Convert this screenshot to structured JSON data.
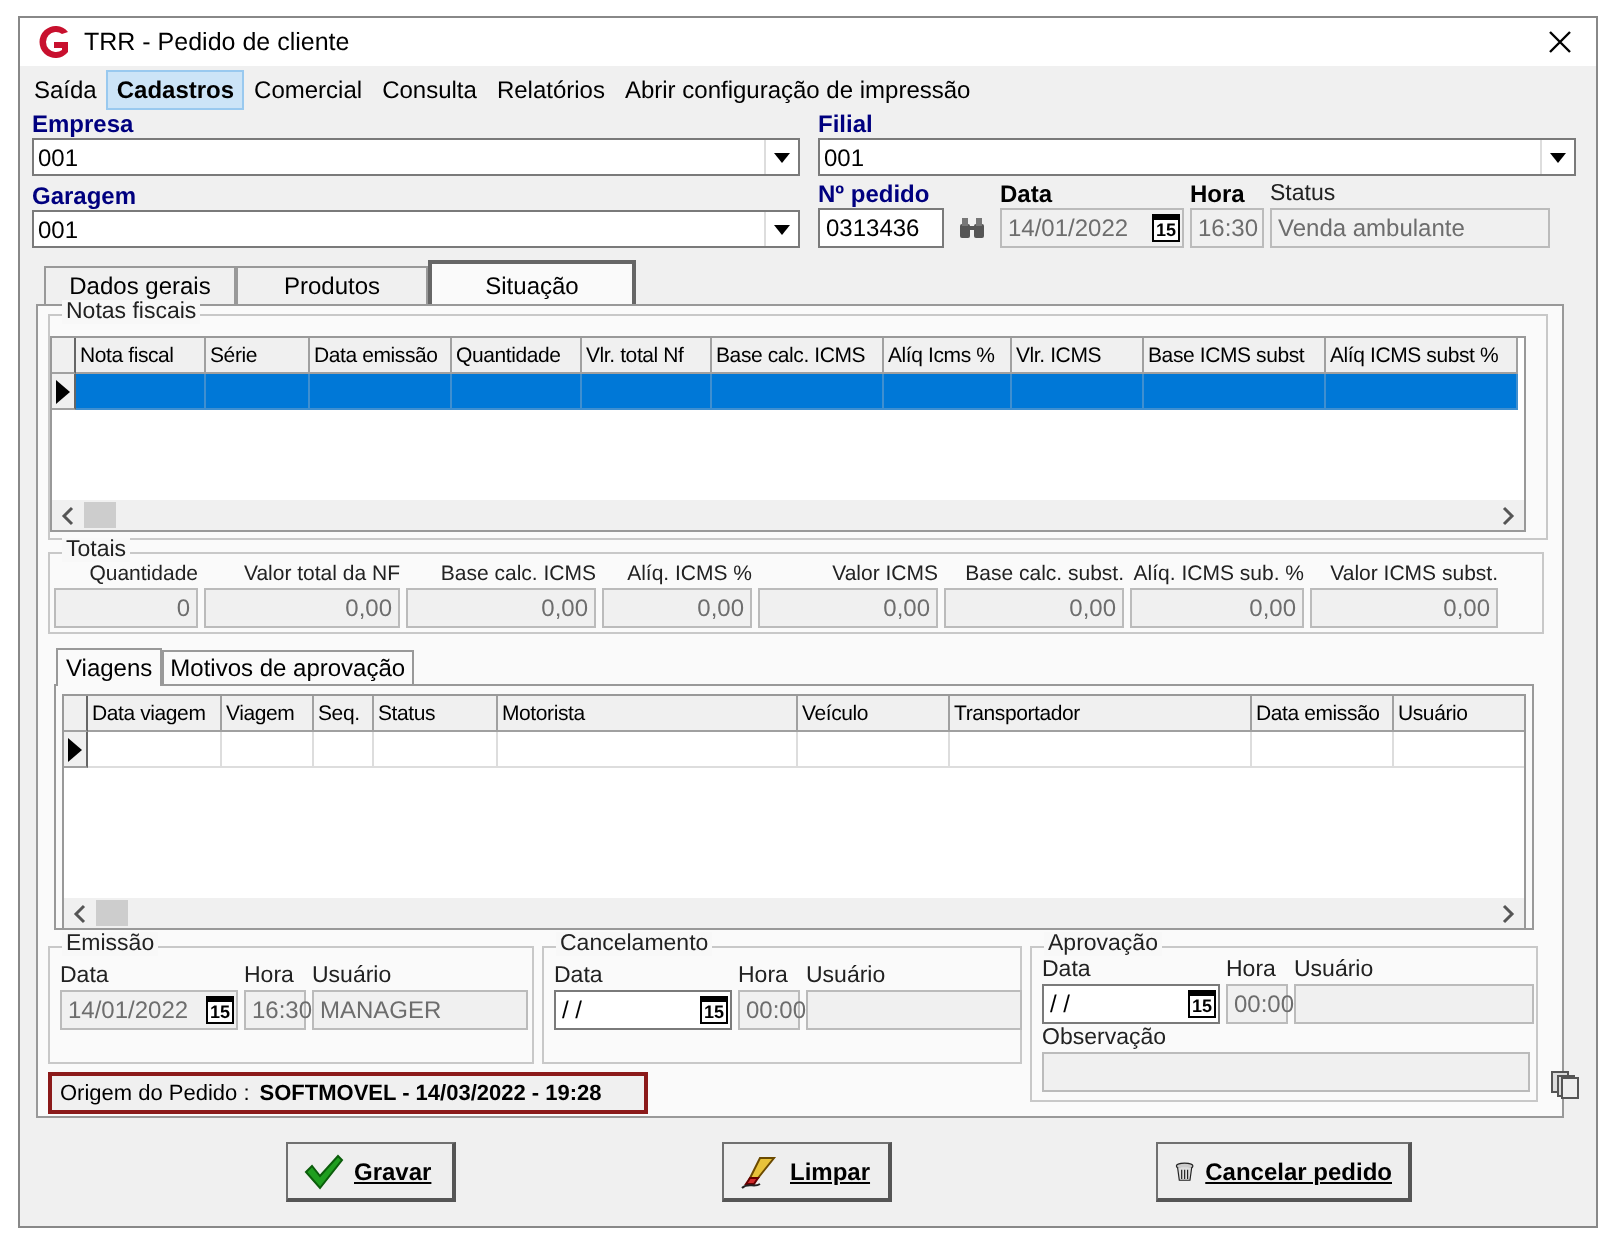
{
  "window": {
    "title": "TRR - Pedido de cliente"
  },
  "menu": [
    {
      "label": "Saída",
      "selected": false
    },
    {
      "label": "Cadastros",
      "selected": true
    },
    {
      "label": "Comercial",
      "selected": false
    },
    {
      "label": "Consulta",
      "selected": false
    },
    {
      "label": "Relatórios",
      "selected": false
    },
    {
      "label": "Abrir configuração de impressão",
      "selected": false
    }
  ],
  "header": {
    "empresa": {
      "label": "Empresa",
      "value": "001"
    },
    "filial": {
      "label": "Filial",
      "value": "001"
    },
    "garagem": {
      "label": "Garagem",
      "value": "001"
    },
    "pedido": {
      "label": "Nº pedido",
      "value": "0313436",
      "disabled": false
    },
    "data": {
      "label": "Data",
      "value": "14/01/2022",
      "button": "15",
      "disabled": true
    },
    "hora": {
      "label": "Hora",
      "value": "16:30",
      "disabled": true
    },
    "status": {
      "label": "Status",
      "value": "Venda ambulante",
      "disabled": true
    }
  },
  "tabs": [
    {
      "label": "Dados gerais",
      "selected": false
    },
    {
      "label": "Produtos",
      "selected": false
    },
    {
      "label": "Situação",
      "selected": true
    }
  ],
  "notas_fiscais": {
    "title": "Notas fiscais",
    "columns": [
      "Nota fiscal",
      "Série",
      "Data emissão",
      "Quantidade",
      "Vlr. total Nf",
      "Base calc. ICMS",
      "Alíq Icms %",
      "Vlr. ICMS",
      "Base ICMS subst",
      "Alíq ICMS subst %"
    ],
    "rows": [
      {
        "current": true,
        "selected": true
      }
    ]
  },
  "totais": {
    "title": "Totais",
    "fields": [
      {
        "label": "Quantidade",
        "value": "0",
        "disabled": true
      },
      {
        "label": "Valor total da NF",
        "value": "0,00",
        "disabled": true
      },
      {
        "label": "Base calc. ICMS",
        "value": "0,00",
        "disabled": true
      },
      {
        "label": "Alíq. ICMS %",
        "value": "0,00",
        "disabled": true
      },
      {
        "label": "Valor ICMS",
        "value": "0,00",
        "disabled": true
      },
      {
        "label": "Base calc. subst.",
        "value": "0,00",
        "disabled": true
      },
      {
        "label": "Alíq. ICMS sub. %",
        "value": "0,00",
        "disabled": true
      },
      {
        "label": "Valor ICMS subst.",
        "value": "0,00",
        "disabled": true
      }
    ]
  },
  "subtabs": [
    {
      "label": "Viagens",
      "selected": true
    },
    {
      "label": "Motivos de aprovação",
      "selected": false
    }
  ],
  "viagens": {
    "columns": [
      "Data viagem",
      "Viagem",
      "Seq.",
      "Status",
      "Motorista",
      "Veículo",
      "Transportador",
      "Data emissão",
      "Usuário"
    ],
    "rows": [
      {
        "current": true,
        "selected": false
      }
    ]
  },
  "emissao": {
    "title": "Emissão",
    "data": {
      "label": "Data",
      "value": "14/01/2022",
      "button": "15",
      "disabled": true
    },
    "hora": {
      "label": "Hora",
      "value": "16:30",
      "disabled": true
    },
    "usuario": {
      "label": "Usuário",
      "value": "MANAGER",
      "disabled": true
    }
  },
  "cancelamento": {
    "title": "Cancelamento",
    "data": {
      "label": "Data",
      "value": " / /",
      "button": "15",
      "disabled": false
    },
    "hora": {
      "label": "Hora",
      "value": "00:00",
      "disabled": true
    },
    "usuario": {
      "label": "Usuário",
      "disabled": true
    }
  },
  "aprovacao": {
    "title": "Aprovação",
    "data": {
      "label": "Data",
      "value": " / /",
      "button": "15",
      "disabled": false
    },
    "hora": {
      "label": "Hora",
      "value": "00:00",
      "disabled": true
    },
    "usuario": {
      "label": "Usuário",
      "disabled": true
    },
    "observacao": {
      "label": "Observação",
      "disabled": true
    }
  },
  "origem": {
    "label": "Origem do Pedido :",
    "value": "SOFTMOVEL - 14/03/2022 - 19:28"
  },
  "buttons": [
    {
      "label": "Gravar",
      "kind": "save"
    },
    {
      "label": "Limpar",
      "kind": "clear"
    },
    {
      "label": "Cancelar pedido",
      "kind": "cancel"
    }
  ]
}
